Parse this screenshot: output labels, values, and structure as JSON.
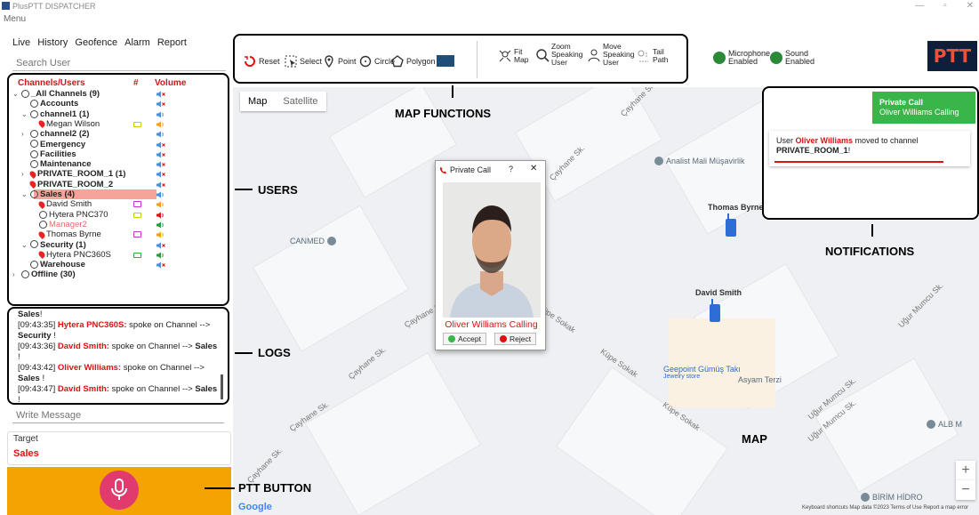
{
  "window": {
    "title": "PlusPTT DISPATCHER"
  },
  "menu": {
    "label": "Menu"
  },
  "tabs": [
    "Live",
    "History",
    "Geofence",
    "Alarm",
    "Report"
  ],
  "search": {
    "placeholder": "Search User"
  },
  "tree": {
    "headers": {
      "channels": "Channels/Users",
      "hash": "#",
      "volume": "Volume"
    },
    "rows": [
      {
        "label": "_All Channels (9)",
        "level": 0,
        "chev": "v",
        "icon": "user",
        "bold": true,
        "vol": "muted"
      },
      {
        "label": "Accounts",
        "level": 1,
        "icon": "user",
        "bold": true,
        "vol": "muted"
      },
      {
        "label": "channel1 (1)",
        "level": 1,
        "chev": "v",
        "icon": "user",
        "bold": true,
        "vol": "on"
      },
      {
        "label": "Megan Wilson",
        "level": 2,
        "icon": "pin",
        "bold": false,
        "vol": "low",
        "extra": "battery"
      },
      {
        "label": "channel2 (2)",
        "level": 1,
        "chev": ">",
        "icon": "user",
        "bold": true,
        "vol": "on"
      },
      {
        "label": "Emergency",
        "level": 1,
        "icon": "user",
        "bold": true,
        "vol": "muted"
      },
      {
        "label": "Facilities",
        "level": 1,
        "icon": "user",
        "bold": true,
        "vol": "muted"
      },
      {
        "label": "Maintenance",
        "level": 1,
        "icon": "user",
        "bold": true,
        "vol": "muted"
      },
      {
        "label": "PRIVATE_ROOM_1 (1)",
        "level": 1,
        "chev": ">",
        "icon": "pin",
        "bold": true,
        "vol": "muted"
      },
      {
        "label": "PRIVATE_ROOM_2",
        "level": 1,
        "icon": "pin",
        "bold": true,
        "vol": "muted"
      },
      {
        "label": "Sales (4)",
        "level": 1,
        "chev": "v",
        "icon": "user",
        "bold": true,
        "vol": "on",
        "highlight": true
      },
      {
        "label": "David Smith",
        "level": 2,
        "icon": "pin",
        "bold": false,
        "vol": "low",
        "extra": "badge"
      },
      {
        "label": "Hytera PNC370",
        "level": 2,
        "icon": "user",
        "bold": false,
        "vol": "red",
        "extra": "battery"
      },
      {
        "label": "Manager2",
        "level": 2,
        "icon": "user",
        "bold": false,
        "vol": "green",
        "muted_text": true
      },
      {
        "label": "Thomas Byrne",
        "level": 2,
        "icon": "pin",
        "bold": false,
        "vol": "low",
        "extra": "badge"
      },
      {
        "label": "Security (1)",
        "level": 1,
        "chev": "v",
        "icon": "user",
        "bold": true,
        "vol": "muted"
      },
      {
        "label": "Hytera PNC360S",
        "level": 2,
        "icon": "pin",
        "bold": false,
        "vol": "green",
        "extra": "battery-green"
      },
      {
        "label": "Warehouse",
        "level": 1,
        "icon": "user",
        "bold": true,
        "vol": "muted"
      },
      {
        "label": "Offline (30)",
        "level": 0,
        "chev": ">",
        "icon": "user",
        "bold": true,
        "vol": "none"
      }
    ]
  },
  "logs": {
    "lines": [
      [
        {
          "t": "Sales",
          "s": "b"
        },
        {
          "t": "!",
          "s": ""
        }
      ],
      [
        {
          "t": "[09:43:35] ",
          "s": ""
        },
        {
          "t": "Hytera PNC360S:",
          "s": "r"
        },
        {
          "t": " spoke on Channel -->",
          "s": ""
        }
      ],
      [
        {
          "t": "Security",
          "s": "b"
        },
        {
          "t": " !",
          "s": ""
        }
      ],
      [
        {
          "t": "[09:43:36] ",
          "s": ""
        },
        {
          "t": "David Smith:",
          "s": "r"
        },
        {
          "t": " spoke on Channel --> ",
          "s": ""
        },
        {
          "t": "Sales",
          "s": "b"
        },
        {
          "t": " !",
          "s": ""
        }
      ],
      [
        {
          "t": "[09:43:42] ",
          "s": ""
        },
        {
          "t": "Oliver Williams:",
          "s": "r"
        },
        {
          "t": " spoke on Channel -->",
          "s": ""
        }
      ],
      [
        {
          "t": "Sales",
          "s": "b"
        },
        {
          "t": " !",
          "s": ""
        }
      ],
      [
        {
          "t": "[09:43:47] ",
          "s": ""
        },
        {
          "t": "David Smith:",
          "s": "r"
        },
        {
          "t": " spoke on Channel --> ",
          "s": ""
        },
        {
          "t": "Sales",
          "s": "b"
        },
        {
          "t": " !",
          "s": ""
        }
      ],
      [
        {
          "t": "[09:44:03] User ",
          "s": ""
        },
        {
          "t": "Oliver Williams",
          "s": "r"
        },
        {
          "t": " moved to channel",
          "s": ""
        }
      ],
      [
        {
          "t": "PRIVATE_ROOM_1",
          "s": "b"
        },
        {
          "t": "!",
          "s": ""
        }
      ]
    ]
  },
  "message": {
    "placeholder": "Write Message"
  },
  "target": {
    "label": "Target",
    "value": "Sales"
  },
  "toolbar": {
    "reset": "Reset",
    "select": "Select",
    "point": "Point",
    "circle": "Circle",
    "polygon": "Polygon",
    "fit_map": [
      "Fit",
      "Map"
    ],
    "zoom_speaking": [
      "Zoom",
      "Speaking",
      "User"
    ],
    "move_speaking": [
      "Move",
      "Speaking",
      "User"
    ],
    "tail_path": [
      "Tail",
      "Path"
    ],
    "polygon_color": "#1f4e78"
  },
  "status": {
    "microphone": [
      "Microphone",
      "Enabled"
    ],
    "sound": [
      "Sound",
      "Enabled"
    ]
  },
  "logo": {
    "text": "PTT"
  },
  "map": {
    "tabs": {
      "map": "Map",
      "satellite": "Satellite"
    },
    "streets": [
      "Çayhane Sk.",
      "Çayhane Sk.",
      "Çayhane Sk.",
      "Çayhane Sk.",
      "Çayhane Sk.",
      "Küpe Sokak",
      "Küpe Sokak",
      "Küpe Sokak",
      "Uğur Mumcu Sk.",
      "Uğur Mumcu Sk.",
      "Çayhane Sk.",
      "Uğur Mumcu Sk."
    ],
    "pois": {
      "analist": "Analist Mali Müşavirlik",
      "canmed": "CANMED",
      "geepoint": "Geepoint Gümüş Takı",
      "geepoint_sub": "Jewelry store",
      "asyam": "Asyam Terzi",
      "alb": "ALB M",
      "birim": "BİRİM HİDRO"
    },
    "markers": {
      "thomas": "Thomas Byrne",
      "david": "David Smith"
    },
    "google": "Google",
    "footer": "Keyboard shortcuts   Map data ©2023   Terms of Use   Report a map error"
  },
  "annotations": {
    "map_functions": "MAP FUNCTIONS",
    "users": "USERS",
    "logs": "LOGS",
    "ptt_button": "PTT BUTTON",
    "notifications": "NOTIFICATIONS",
    "map": "MAP"
  },
  "notification": {
    "title": "Private Call",
    "subtitle": "Oliver Williams Calling",
    "msg_prefix": "User ",
    "msg_name": "Oliver Williams",
    "msg_mid": " moved to channel",
    "msg_channel": "PRIVATE_ROOM_1",
    "msg_end": "!"
  },
  "dialog": {
    "title": "Private Call",
    "help": "?",
    "close": "✕",
    "calling": "Oliver Williams Calling",
    "accept": "Accept",
    "reject": "Reject"
  },
  "zoom": {
    "plus": "+",
    "minus": "−"
  },
  "colors": {
    "accent_red": "#d11111",
    "ptt_orange": "#f5a300",
    "mic_pink": "#e03a6e",
    "notif_green": "#3ab54a"
  }
}
